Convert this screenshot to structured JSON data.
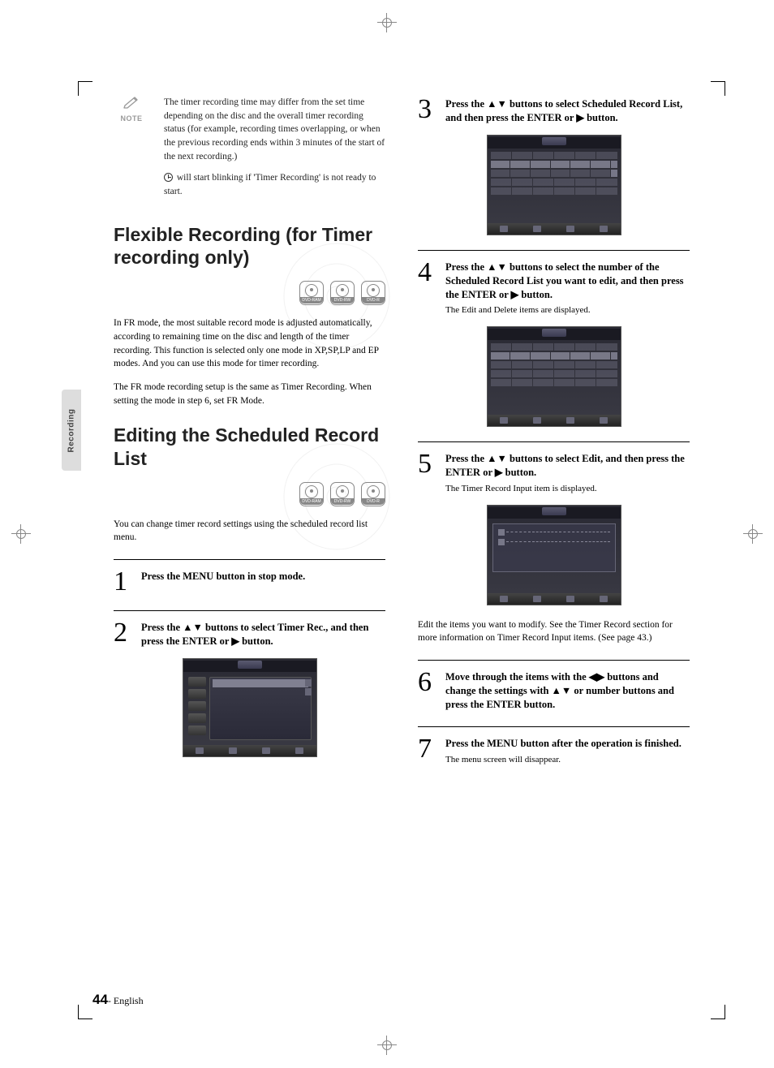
{
  "sidebar": {
    "label": "Recording"
  },
  "note": {
    "label": "NOTE",
    "p1_a": "The timer recording time may differ from the set time depending on the disc and the overall timer recording status (for example, recording times overlapping, or when the previous recording ends within 3 minutes of the start of the next recording.)",
    "p2_a": " will start blinking if 'Timer Recording' is not ready to start."
  },
  "sections": {
    "flexible_title": "Flexible Recording (for Timer recording only)",
    "editing_title": "Editing the Scheduled Record List"
  },
  "disc_labels": {
    "ram": "DVD-RAM",
    "rw": "DVD-RW",
    "r": "DVD-R"
  },
  "flexible": {
    "p1": "In FR mode, the most suitable record mode is adjusted automatically, according to remaining time on the disc and length of the timer recording. This function is selected only one mode in XP,SP,LP and EP modes. And you can use this mode for timer recording.",
    "p2": "The FR mode recording setup is the same as Timer Recording. When setting the mode in step 6, set FR Mode."
  },
  "editing": {
    "intro": "You can change timer record settings using the scheduled record list menu."
  },
  "steps": {
    "s1": "Press the MENU button in stop mode.",
    "s2": "Press the ▲▼ buttons to select Timer Rec., and then press the ENTER or ▶ button.",
    "s3": "Press the ▲▼ buttons to select Scheduled Record List, and then press the ENTER or ▶ button.",
    "s4": "Press the ▲▼ buttons to select the number of the Scheduled Record List you want to edit, and then press the ENTER or ▶ button.",
    "s4_note": "The Edit and Delete items are displayed.",
    "s5": "Press the ▲▼ buttons to select Edit, and then press the ENTER or ▶ button.",
    "s5_note": "The Timer Record Input item is displayed.",
    "s5_para": "Edit the items you want to modify. See the Timer Record section for more information on Timer Record Input items. (See page 43.)",
    "s6": "Move through the items with the ◀▶ buttons and change the settings with ▲▼ or number buttons and press the ENTER button.",
    "s7": "Press the MENU button after the operation is finished.",
    "s7_note": "The menu screen will disappear."
  },
  "footer": {
    "page": "44",
    "lang": "- English"
  }
}
